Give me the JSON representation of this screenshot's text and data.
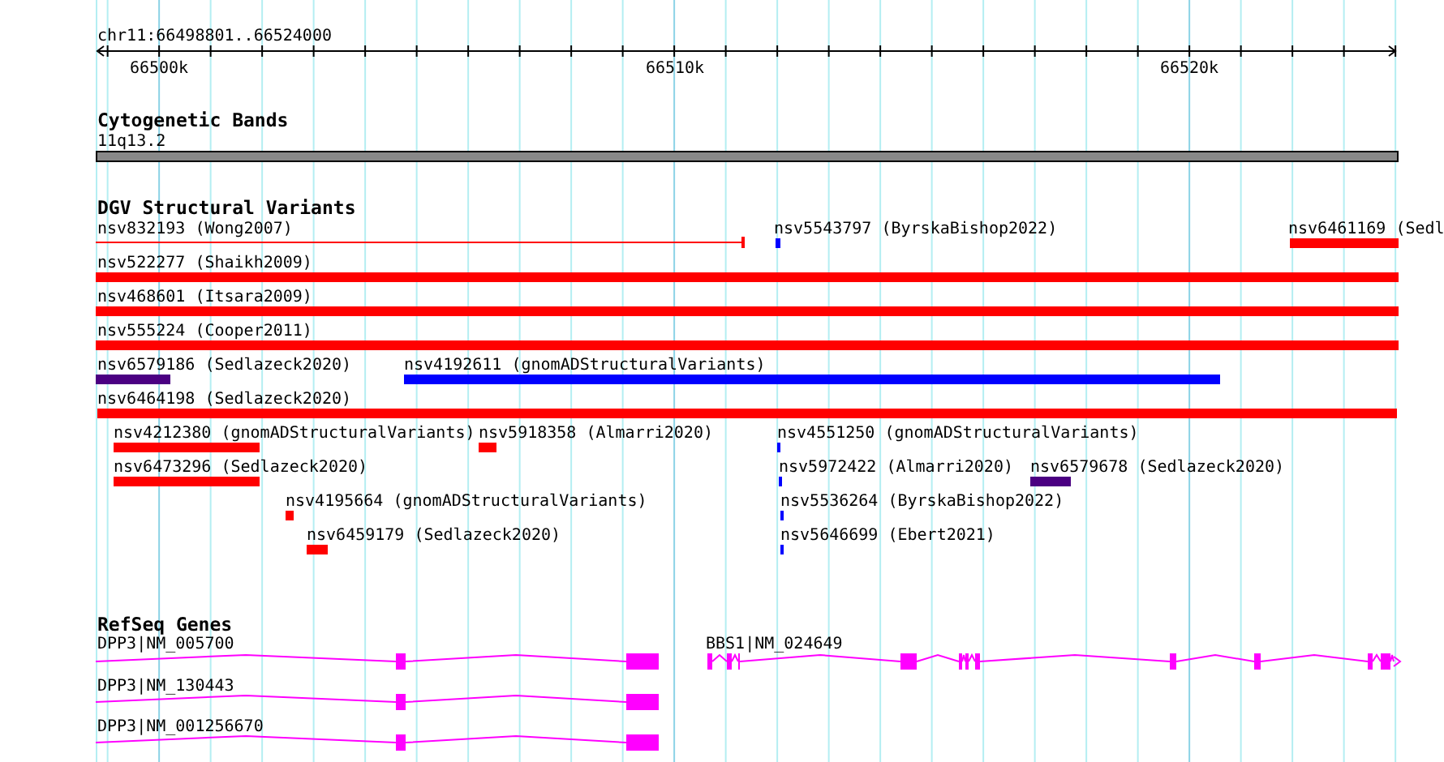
{
  "ruler": {
    "location": "chr11:66498801..66524000",
    "ticks": [
      "66500k",
      "66510k",
      "66520k"
    ]
  },
  "tracks": [
    {
      "title": "Cytogenetic Bands",
      "kind": "bands",
      "features": [
        {
          "label": "11q13.2"
        }
      ]
    },
    {
      "title": "DGV Structural Variants",
      "kind": "variants",
      "features": [
        {
          "label": "nsv832193 (Wong2007)",
          "color": "#ff0000"
        },
        {
          "label": "nsv5543797 (ByrskaBishop2022)",
          "color": "#0000ff"
        },
        {
          "label": "nsv6461169 (Sedl",
          "color": "#ff0000"
        },
        {
          "label": "nsv522277 (Shaikh2009)",
          "color": "#ff0000"
        },
        {
          "label": "nsv468601 (Itsara2009)",
          "color": "#ff0000"
        },
        {
          "label": "nsv555224 (Cooper2011)",
          "color": "#ff0000"
        },
        {
          "label": "nsv6579186 (Sedlazeck2020)",
          "color": "#4b0082"
        },
        {
          "label": "nsv4192611 (gnomADStructuralVariants)",
          "color": "#0000ff"
        },
        {
          "label": "nsv6464198 (Sedlazeck2020)",
          "color": "#ff0000"
        },
        {
          "label": "nsv4212380 (gnomADStructuralVariants)",
          "color": "#ff0000"
        },
        {
          "label": "nsv5918358 (Almarri2020)",
          "color": "#ff0000"
        },
        {
          "label": "nsv4551250 (gnomADStructuralVariants)",
          "color": "#0000ff"
        },
        {
          "label": "nsv6473296 (Sedlazeck2020)",
          "color": "#ff0000"
        },
        {
          "label": "nsv5972422 (Almarri2020)",
          "color": "#0000ff"
        },
        {
          "label": "nsv6579678 (Sedlazeck2020)",
          "color": "#4b0082"
        },
        {
          "label": "nsv4195664 (gnomADStructuralVariants)",
          "color": "#ff0000"
        },
        {
          "label": "nsv5536264 (ByrskaBishop2022)",
          "color": "#0000ff"
        },
        {
          "label": "nsv6459179 (Sedlazeck2020)",
          "color": "#ff0000"
        },
        {
          "label": "nsv5646699 (Ebert2021)",
          "color": "#0000ff"
        }
      ]
    },
    {
      "title": "RefSeq Genes",
      "kind": "genes",
      "features": [
        {
          "label": "DPP3|NM_005700"
        },
        {
          "label": "DPP3|NM_130443"
        },
        {
          "label": "DPP3|NM_001256670"
        },
        {
          "label": "BBS1|NM_024649"
        }
      ]
    }
  ]
}
